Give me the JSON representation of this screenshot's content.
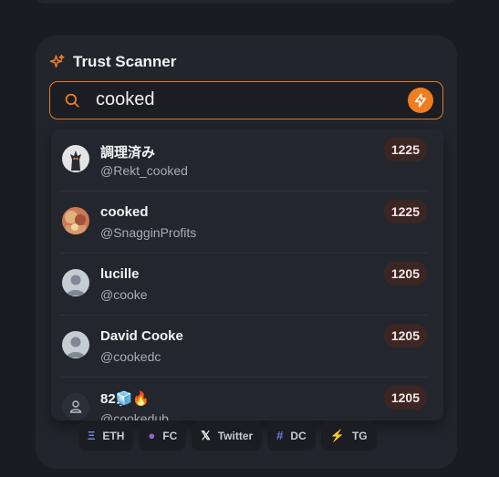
{
  "header": {
    "title": "Trust Scanner",
    "icon": "sparkles-icon"
  },
  "search": {
    "value": "cooked",
    "action_icon": "lightning-icon"
  },
  "colors": {
    "accent": "#f07d22",
    "score_bg": "#3b2623"
  },
  "results": [
    {
      "name": "調理済み",
      "handle": "@Rekt_cooked",
      "score": "1225",
      "avatar": "dark-character-avatar"
    },
    {
      "name": "cooked",
      "handle": "@SnagginProfits",
      "score": "1225",
      "avatar": "photo-avatar"
    },
    {
      "name": "lucille",
      "handle": "@cooke",
      "score": "1205",
      "avatar": "default-user-avatar"
    },
    {
      "name": "David Cooke",
      "handle": "@cookedc",
      "score": "1205",
      "avatar": "default-user-avatar"
    },
    {
      "name": "82🧊🔥",
      "handle": "@cookedub",
      "score": "1205",
      "avatar": "user-outline-avatar"
    }
  ],
  "platforms": [
    {
      "icon": "Ξ",
      "label": "ETH",
      "color": "#7c83e8"
    },
    {
      "icon": "●",
      "label": "FC",
      "color": "#8a63d2"
    },
    {
      "icon": "𝕏",
      "label": "Twitter",
      "color": "#ffffff"
    },
    {
      "icon": "#",
      "label": "DC",
      "color": "#6b7bea"
    },
    {
      "icon": "⚡",
      "label": "TG",
      "color": "#f07d22"
    }
  ]
}
